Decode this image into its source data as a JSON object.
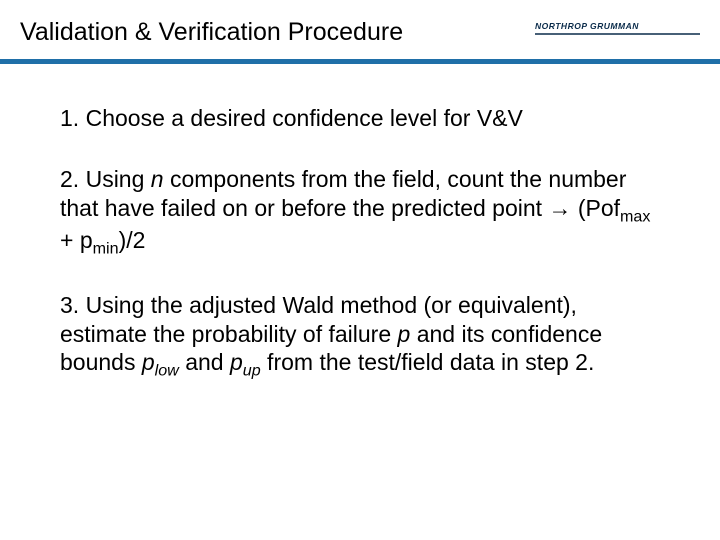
{
  "header": {
    "title": "Validation & Verification Procedure",
    "logo_text_top": "NORTHROP GRUMMAN"
  },
  "steps": {
    "s1": {
      "num": "1.",
      "text": "Choose a desired confidence level for V&V"
    },
    "s2": {
      "num": "2.",
      "prefix": "Using ",
      "var_n": "n",
      "mid": " components from the field, count the number that have failed on or before the predicted point ",
      "arrow": "→",
      "formula_open": " (Pof",
      "sub1": "max",
      "formula_mid": " + p",
      "sub2": "min",
      "formula_close": ")/2"
    },
    "s3": {
      "num": "3.",
      "t1": "Using the adjusted Wald method (or equivalent), estimate the probability of failure ",
      "var_p": "p",
      "t2": " and its confidence bounds ",
      "var_plow": "p",
      "sub_low": "low",
      "t3": "  and  ",
      "var_pup": "p",
      "sub_up": "up",
      "t4": " from the test/field data in step 2."
    }
  }
}
